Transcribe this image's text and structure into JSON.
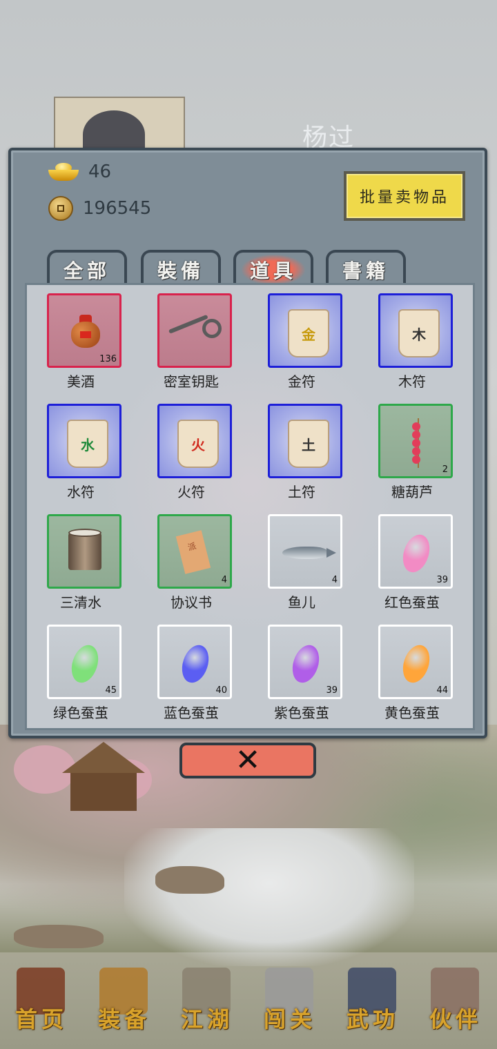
{
  "hero": {
    "name": "杨过"
  },
  "currency": {
    "gold_ingot": "46",
    "copper_coin": "196545"
  },
  "sell_button": "批量卖物品",
  "tabs": [
    {
      "label": "全部",
      "active": false
    },
    {
      "label": "裝備",
      "active": false
    },
    {
      "label": "道具",
      "active": true
    },
    {
      "label": "書籍",
      "active": false
    }
  ],
  "items": [
    {
      "name": "美酒",
      "count": "136",
      "quality": "red",
      "icon": "wine-jar-icon"
    },
    {
      "name": "密室钥匙",
      "count": "",
      "quality": "red",
      "icon": "key-icon"
    },
    {
      "name": "金符",
      "count": "",
      "quality": "blue",
      "icon": "talisman-icon",
      "glyph": "金",
      "glyph_color": "#c79a0c"
    },
    {
      "name": "木符",
      "count": "",
      "quality": "blue",
      "icon": "talisman-icon",
      "glyph": "木",
      "glyph_color": "#333333"
    },
    {
      "name": "水符",
      "count": "",
      "quality": "blue",
      "icon": "talisman-icon",
      "glyph": "水",
      "glyph_color": "#1f8a3a"
    },
    {
      "name": "火符",
      "count": "",
      "quality": "blue",
      "icon": "talisman-icon",
      "glyph": "火",
      "glyph_color": "#d12a1e"
    },
    {
      "name": "土符",
      "count": "",
      "quality": "blue",
      "icon": "talisman-icon",
      "glyph": "土",
      "glyph_color": "#333333"
    },
    {
      "name": "糖葫芦",
      "count": "2",
      "quality": "green",
      "icon": "candied-haws-icon"
    },
    {
      "name": "三清水",
      "count": "",
      "quality": "green",
      "icon": "bucket-icon"
    },
    {
      "name": "协议书",
      "count": "4",
      "quality": "green",
      "icon": "scroll-icon",
      "glyph": "派"
    },
    {
      "name": "鱼儿",
      "count": "4",
      "quality": "white",
      "icon": "fish-icon"
    },
    {
      "name": "红色蚕茧",
      "count": "39",
      "quality": "white",
      "icon": "cocoon-icon",
      "color": "#f28bc4"
    },
    {
      "name": "绿色蚕茧",
      "count": "45",
      "quality": "white",
      "icon": "cocoon-icon",
      "color": "#7fe07a"
    },
    {
      "name": "蓝色蚕茧",
      "count": "40",
      "quality": "white",
      "icon": "cocoon-icon",
      "color": "#5b5ef2"
    },
    {
      "name": "紫色蚕茧",
      "count": "39",
      "quality": "white",
      "icon": "cocoon-icon",
      "color": "#b05ee8"
    },
    {
      "name": "黄色蚕茧",
      "count": "44",
      "quality": "white",
      "icon": "cocoon-icon",
      "color": "#ffa53a"
    }
  ],
  "close_icon": "close-icon",
  "nav": [
    {
      "label": "首页",
      "icon": "home-icon",
      "color": "#7b3b22",
      "active": true
    },
    {
      "label": "装备",
      "icon": "armor-icon",
      "color": "#b07a2c",
      "active": false
    },
    {
      "label": "江湖",
      "icon": "map-scroll-icon",
      "color": "#8a8170",
      "active": false
    },
    {
      "label": "闯关",
      "icon": "crossed-swords-icon",
      "color": "#9a9a9a",
      "active": false
    },
    {
      "label": "武功",
      "icon": "book-icon",
      "color": "#3e4a66",
      "active": false
    },
    {
      "label": "伙伴",
      "icon": "partners-icon",
      "color": "#8a6f62",
      "active": false
    }
  ]
}
